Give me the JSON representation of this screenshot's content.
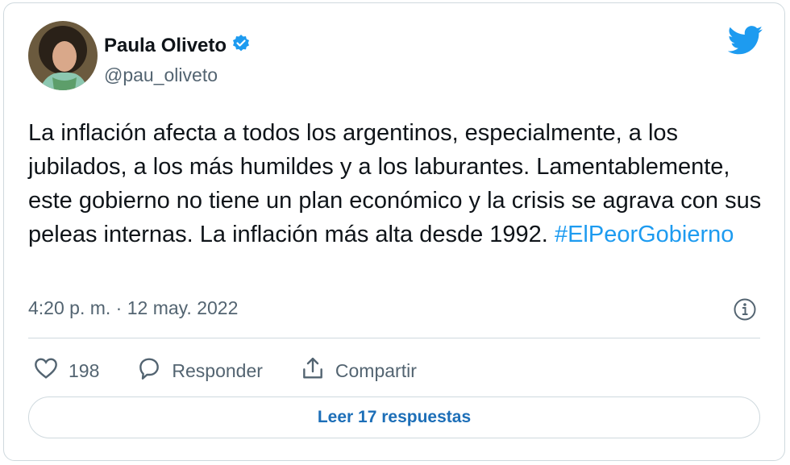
{
  "author": {
    "name": "Paula Oliveto",
    "handle": "@pau_oliveto",
    "verified": true
  },
  "tweet": {
    "text_before_hashtag": "La inflación afecta a todos los argentinos, especialmente, a los jubilados, a los más humildes y a los laburantes. Lamentablemente, este gobierno no tiene un plan económico y la crisis se agrava con sus peleas internas. La inflación más alta desde 1992. ",
    "hashtag": "#ElPeorGobierno",
    "timestamp": "4:20 p. m. · 12 may. 2022"
  },
  "actions": {
    "like_count": "198",
    "reply_label": "Responder",
    "share_label": "Compartir"
  },
  "read_replies_label": "Leer 17 respuestas",
  "icons": [
    "verified-badge-icon",
    "twitter-bird-icon",
    "info-icon",
    "heart-icon",
    "reply-icon",
    "share-icon"
  ],
  "colors": {
    "accent": "#1d9bf0",
    "link_button": "#1d6fb8",
    "secondary_text": "#536471",
    "border": "#cfd9de"
  }
}
